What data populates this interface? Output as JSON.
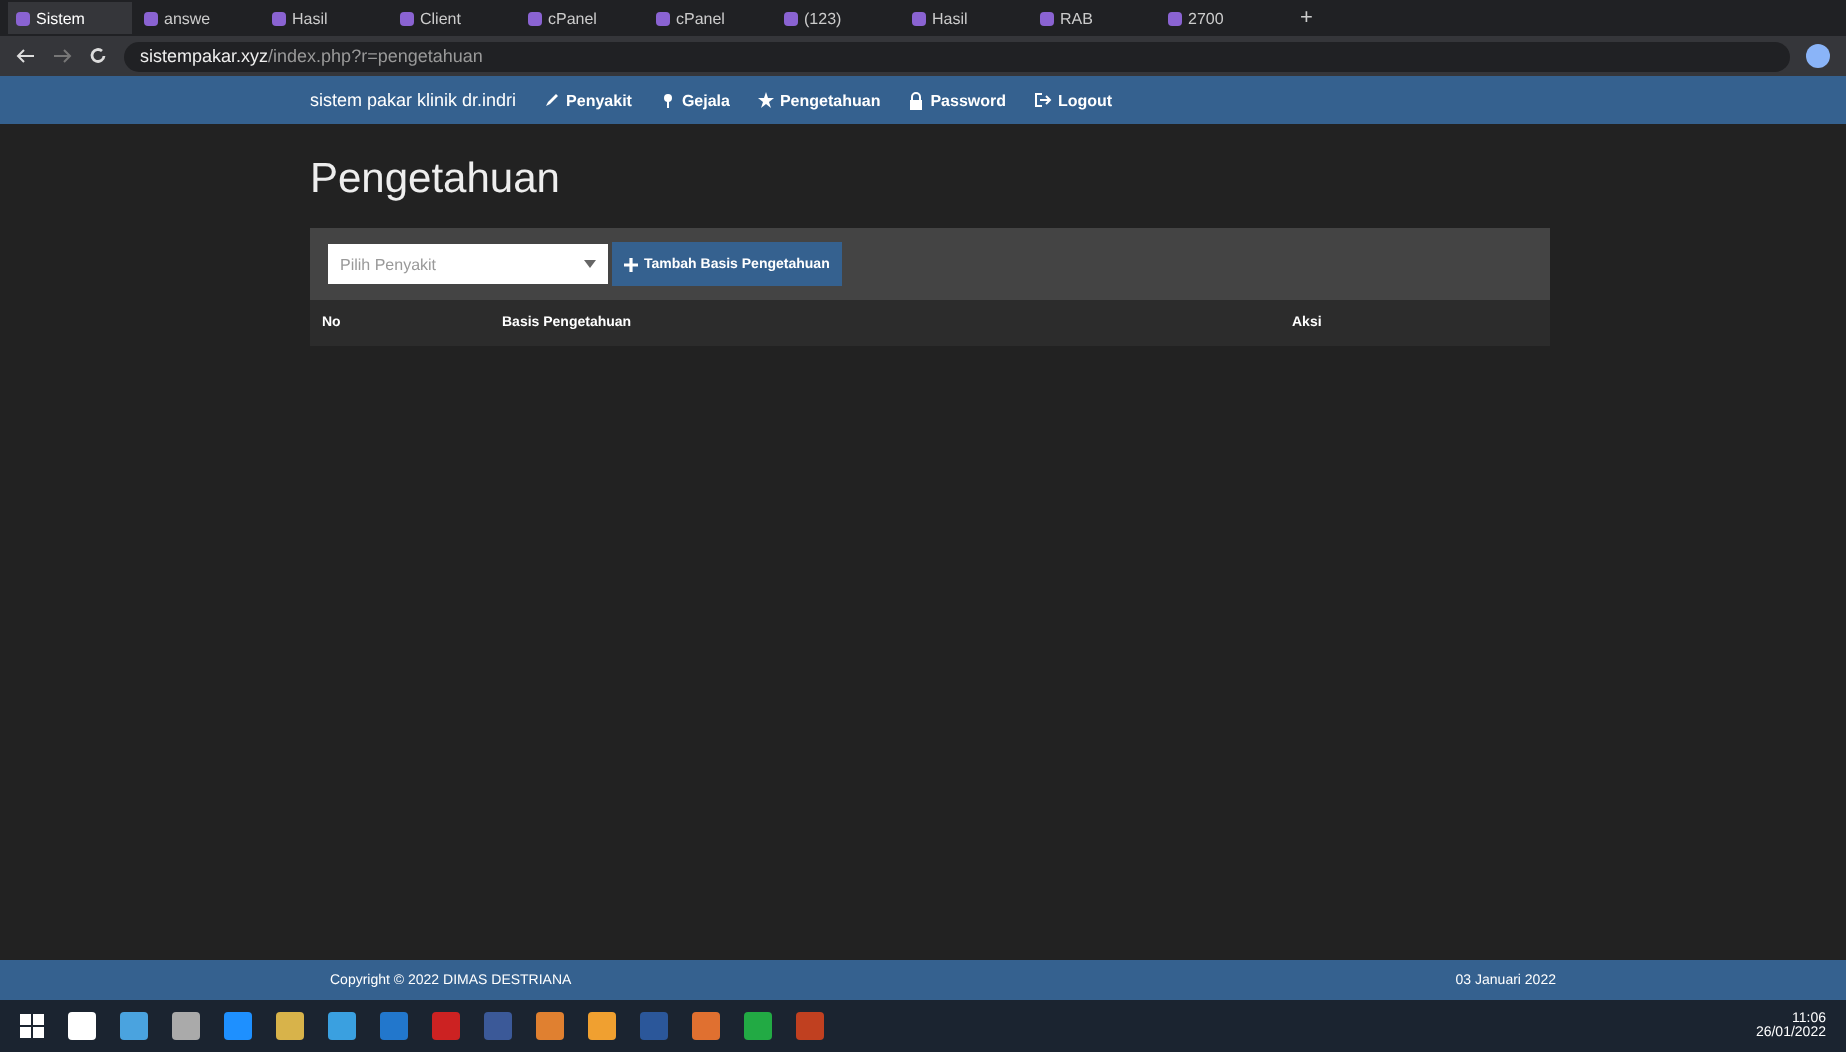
{
  "browser": {
    "tabs": [
      {
        "label": "Sistem",
        "selected": true
      },
      {
        "label": "answe",
        "selected": false
      },
      {
        "label": "Hasil",
        "selected": false
      },
      {
        "label": "Client",
        "selected": false
      },
      {
        "label": "cPanel",
        "selected": false
      },
      {
        "label": "cPanel",
        "selected": false
      },
      {
        "label": "(123)",
        "selected": false
      },
      {
        "label": "Hasil",
        "selected": false
      },
      {
        "label": "RAB",
        "selected": false
      },
      {
        "label": "2700",
        "selected": false
      }
    ],
    "new_tab": "+",
    "url_host": "sistempakar.xyz",
    "url_path": "/index.php?r=pengetahuan"
  },
  "navbar": {
    "brand": "sistem pakar klinik dr.indri",
    "items": [
      {
        "label": "Penyakit"
      },
      {
        "label": "Gejala"
      },
      {
        "label": "Pengetahuan"
      },
      {
        "label": "Password"
      },
      {
        "label": "Logout"
      }
    ]
  },
  "page": {
    "title": "Pengetahuan",
    "select": {
      "placeholder": "Pilih Penyakit"
    },
    "add_button": "Tambah Basis Pengetahuan",
    "table": {
      "columns": [
        "No",
        "Basis Pengetahuan",
        "Aksi"
      ]
    }
  },
  "footer": {
    "copyright": "Copyright © 2022 DIMAS DESTRIANA",
    "date": "03 Januari 2022"
  },
  "taskbar": {
    "time": "11:06",
    "date": "26/01/2022"
  }
}
